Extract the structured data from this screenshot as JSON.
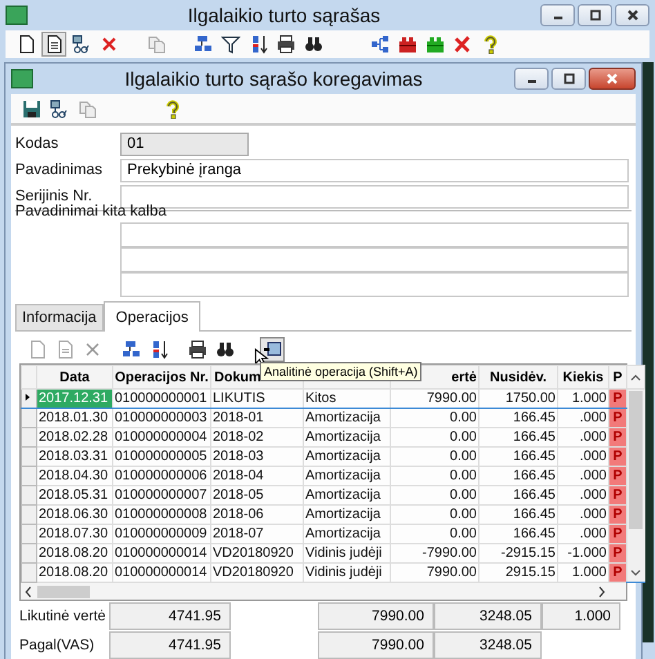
{
  "main_window": {
    "title": "Ilgalaikio turto sąrašas"
  },
  "dialog": {
    "title": "Ilgalaikio turto sąrašo koregavimas"
  },
  "fields": [
    {
      "label": "Kodas",
      "value": "01",
      "kind": "readonly"
    },
    {
      "label": "Pavadinimas",
      "value": "Prekybinė įranga",
      "kind": "text"
    },
    {
      "label": "Serijinis Nr.",
      "kind": "text"
    },
    {
      "label": "Pavadinimai kita kalba",
      "kind": "multi"
    }
  ],
  "tabs": [
    {
      "label": "Informacija",
      "selected": false
    },
    {
      "label": "Operacijos",
      "selected": true
    }
  ],
  "tooltip": "Analitinė operacija (Shift+A)",
  "grid": {
    "columns": [
      {
        "label": "Data"
      },
      {
        "label": "Operacijos Nr."
      },
      {
        "label": "Dokum"
      },
      {},
      {
        "label": "ertė"
      },
      {
        "label": "Nusidėv."
      },
      {
        "label": "Kiekis"
      },
      {
        "label": "P"
      }
    ],
    "rows": [
      {
        "selected": true,
        "cells": [
          "2017.12.31",
          "010000000001",
          "LIKUTIS",
          "Kitos",
          "7990.00",
          "1750.00",
          "1.000",
          "P"
        ]
      },
      {
        "selected": false,
        "cells": [
          "2018.01.30",
          "010000000003",
          "2018-01",
          "Amortizacija",
          "0.00",
          "166.45",
          ".000",
          "P"
        ]
      },
      {
        "selected": false,
        "cells": [
          "2018.02.28",
          "010000000004",
          "2018-02",
          "Amortizacija",
          "0.00",
          "166.45",
          ".000",
          "P"
        ]
      },
      {
        "selected": false,
        "cells": [
          "2018.03.31",
          "010000000005",
          "2018-03",
          "Amortizacija",
          "0.00",
          "166.45",
          ".000",
          "P"
        ]
      },
      {
        "selected": false,
        "cells": [
          "2018.04.30",
          "010000000006",
          "2018-04",
          "Amortizacija",
          "0.00",
          "166.45",
          ".000",
          "P"
        ]
      },
      {
        "selected": false,
        "cells": [
          "2018.05.31",
          "010000000007",
          "2018-05",
          "Amortizacija",
          "0.00",
          "166.45",
          ".000",
          "P"
        ]
      },
      {
        "selected": false,
        "cells": [
          "2018.06.30",
          "010000000008",
          "2018-06",
          "Amortizacija",
          "0.00",
          "166.45",
          ".000",
          "P"
        ]
      },
      {
        "selected": false,
        "cells": [
          "2018.07.30",
          "010000000009",
          "2018-07",
          "Amortizacija",
          "0.00",
          "166.45",
          ".000",
          "P"
        ]
      },
      {
        "selected": false,
        "cells": [
          "2018.08.20",
          "010000000014",
          "VD20180920",
          "Vidinis judėji",
          "-7990.00",
          "-2915.15",
          "-1.000",
          "P"
        ]
      },
      {
        "selected": false,
        "cells": [
          "2018.08.20",
          "010000000014",
          "VD20180920",
          "Vidinis judėji",
          "7990.00",
          "2915.15",
          "1.000",
          "P"
        ]
      }
    ]
  },
  "summary": [
    {
      "label": "Likutinė vertė",
      "values": [
        "4741.95",
        "7990.00",
        "3248.05",
        "1.000"
      ]
    },
    {
      "label": "Pagal(VAS)",
      "values": [
        "4741.95",
        "7990.00",
        "3248.05"
      ]
    }
  ]
}
